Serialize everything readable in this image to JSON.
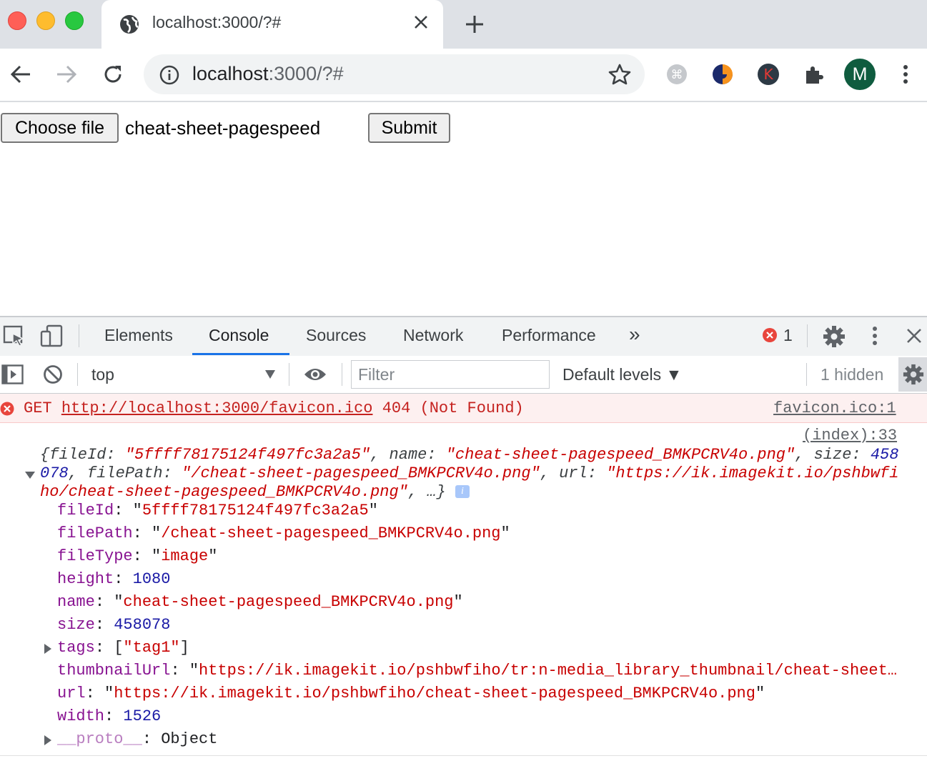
{
  "browser": {
    "tab_title": "localhost:3000/?#",
    "url_host": "localhost",
    "url_rest": ":3000/?#",
    "avatar_letter": "M",
    "extension_badge_letter": "K"
  },
  "page": {
    "choose_file_label": "Choose file",
    "file_name": "cheat-sheet-pagespeed",
    "submit_label": "Submit"
  },
  "devtools": {
    "tabs": [
      "Elements",
      "Console",
      "Sources",
      "Network",
      "Performance"
    ],
    "more_tabs": "»",
    "error_count": "1",
    "context": "top",
    "filter_placeholder": "Filter",
    "levels": "Default levels ▼",
    "hidden_count": "1 hidden"
  },
  "console": {
    "error": {
      "method": "GET",
      "url": "http://localhost:3000/favicon.ico",
      "status": "404 (Not Found)",
      "source": "favicon.ico:1"
    },
    "log_source": "(index):33",
    "summary": {
      "line1_a": "{fileId: ",
      "line1_b": "\"5ffff78175124f497fc3a2a5\"",
      "line1_c": ", name: ",
      "line1_d": "\"cheat-sheet-pagespeed_BMKPCRV4o.png\"",
      "line1_e": ", size: ",
      "line1_f": "458",
      "line2_a": "078",
      "line2_b": ", filePath: ",
      "line2_c": "\"/cheat-sheet-pagespeed_BMKPCRV4o.png\"",
      "line2_d": ", url: ",
      "line2_e": "\"https://ik.imagekit.io/pshbwfi",
      "line3_a": "ho/cheat-sheet-pagespeed_BMKPCRV4o.png\"",
      "line3_b": ", …}",
      "info": "i"
    },
    "props": [
      {
        "key": "fileId",
        "value": "\"5ffff78175124f497fc3a2a5\"",
        "kind": "string"
      },
      {
        "key": "filePath",
        "value": "\"/cheat-sheet-pagespeed_BMKPCRV4o.png\"",
        "kind": "string"
      },
      {
        "key": "fileType",
        "value": "\"image\"",
        "kind": "string"
      },
      {
        "key": "height",
        "value": "1080",
        "kind": "number"
      },
      {
        "key": "name",
        "value": "\"cheat-sheet-pagespeed_BMKPCRV4o.png\"",
        "kind": "string"
      },
      {
        "key": "size",
        "value": "458078",
        "kind": "number"
      },
      {
        "key": "tags",
        "value": "[\"tag1\"]",
        "kind": "array"
      },
      {
        "key": "thumbnailUrl",
        "value": "\"https://ik.imagekit.io/pshbwfiho/tr:n-media_library_thumbnail/cheat-sheet…",
        "kind": "string"
      },
      {
        "key": "url",
        "value": "\"https://ik.imagekit.io/pshbwfiho/cheat-sheet-pagespeed_BMKPCRV4o.png\"",
        "kind": "string"
      },
      {
        "key": "width",
        "value": "1526",
        "kind": "number"
      },
      {
        "key": "__proto__",
        "value": "Object",
        "kind": "object"
      }
    ]
  },
  "colors": {
    "close": "#fe5f57",
    "minimize": "#febc2e",
    "maximize": "#28c840",
    "accent": "#1a73e8",
    "error": "#c5221f",
    "string": "#c80000",
    "number": "#1a1aa6",
    "property": "#881391"
  }
}
